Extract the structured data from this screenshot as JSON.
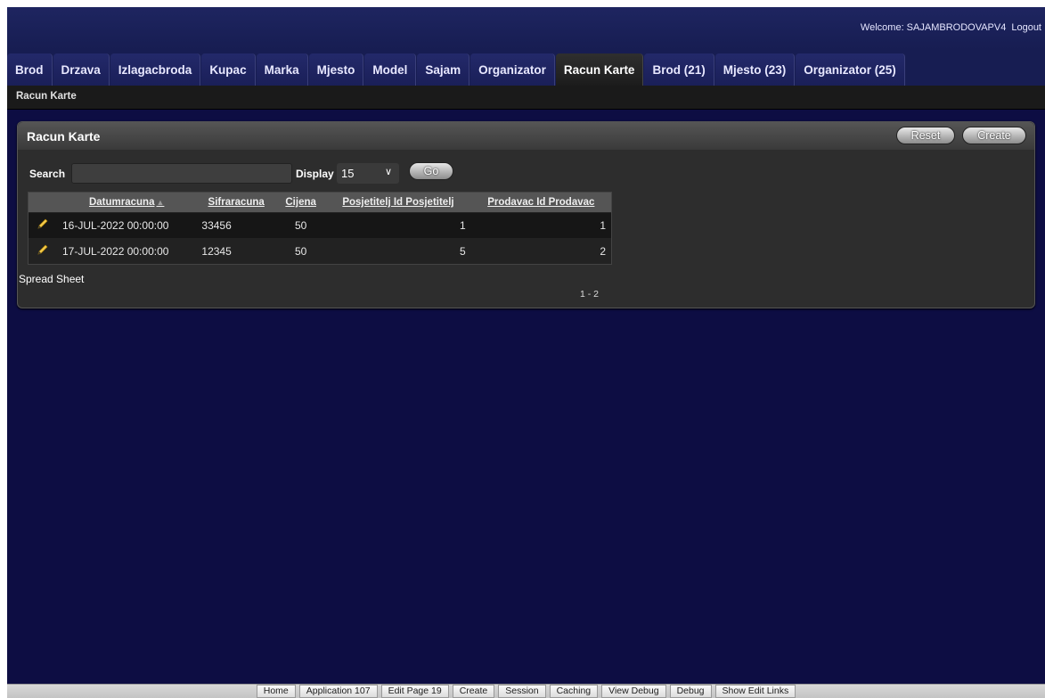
{
  "header": {
    "welcome_label": "Welcome: SAJAMBRODOVAPV4",
    "logout_label": "Logout"
  },
  "tabs": [
    {
      "label": "Brod"
    },
    {
      "label": "Drzava"
    },
    {
      "label": "Izlagacbroda"
    },
    {
      "label": "Kupac"
    },
    {
      "label": "Marka"
    },
    {
      "label": "Mjesto"
    },
    {
      "label": "Model"
    },
    {
      "label": "Sajam"
    },
    {
      "label": "Organizator"
    },
    {
      "label": "Racun Karte",
      "current": true
    },
    {
      "label": "Brod (21)"
    },
    {
      "label": "Mjesto (23)"
    },
    {
      "label": "Organizator (25)"
    }
  ],
  "breadcrumb": "Racun Karte",
  "region": {
    "title": "Racun Karte",
    "reset_label": "Reset",
    "create_label": "Create"
  },
  "search": {
    "label": "Search",
    "value": "",
    "display_label": "Display",
    "display_value": "15",
    "go_label": "Go"
  },
  "report": {
    "columns": [
      "Datumracuna",
      "Sifraracuna",
      "Cijena",
      "Posjetitelj Id Posjetitelj",
      "Prodavac Id Prodavac"
    ],
    "rows": [
      [
        "16-JUL-2022 00:00:00",
        "33456",
        "50",
        "1",
        "1"
      ],
      [
        "17-JUL-2022 00:00:00",
        "12345",
        "50",
        "5",
        "2"
      ]
    ],
    "spreadsheet_label": "Spread Sheet",
    "pagination": "1 - 2"
  },
  "devbar": [
    "Home",
    "Application 107",
    "Edit Page 19",
    "Create",
    "Session",
    "Caching",
    "View Debug",
    "Debug",
    "Show Edit Links"
  ],
  "colors": {
    "page_bg": "#0d0d43",
    "region_bg": "#2d2d2d",
    "tab_current_bg": "#1c1c1c"
  }
}
